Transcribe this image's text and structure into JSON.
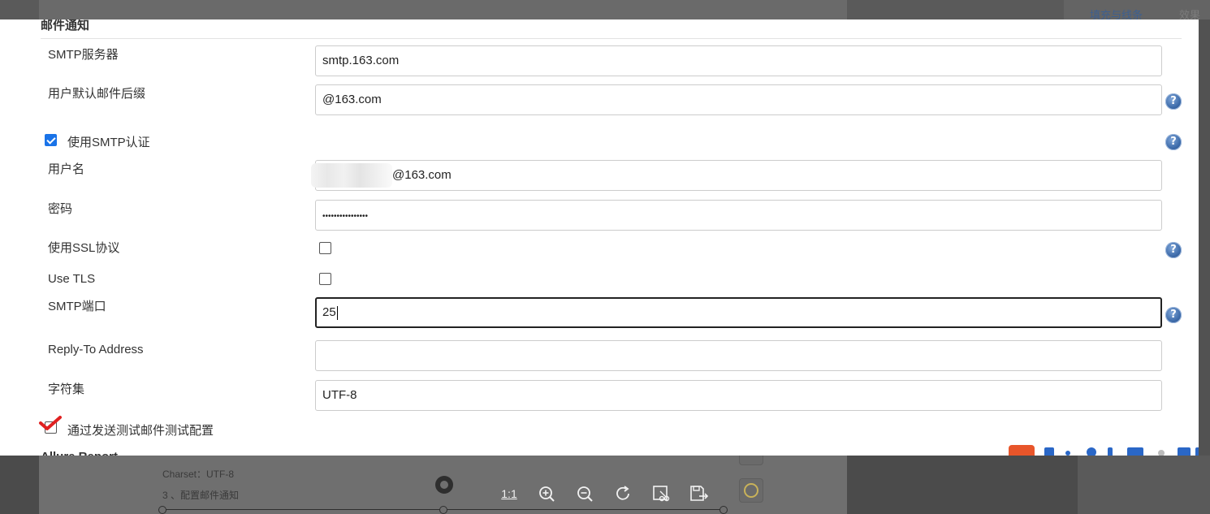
{
  "backdrop": {
    "top_link": "填充与线条",
    "top_link_2": "效果",
    "doc_charset_line": "Charset：UTF-8",
    "doc_step_line": "3 、配置邮件通知",
    "doc_cut_line": "邮件通知"
  },
  "section": {
    "title": "邮件通知",
    "next_title": "Allure Report"
  },
  "fields": {
    "smtp_server": {
      "label": "SMTP服务器",
      "value": "smtp.163.com"
    },
    "default_suffix": {
      "label": "用户默认邮件后缀",
      "value": "@163.com"
    },
    "use_smtp_auth": {
      "label": "使用SMTP认证",
      "checked": true
    },
    "username": {
      "label": "用户名",
      "value": "@163.com"
    },
    "password": {
      "label": "密码",
      "value": "••••••••••••••••"
    },
    "use_ssl": {
      "label": "使用SSL协议",
      "checked": false
    },
    "use_tls": {
      "label": "Use TLS",
      "checked": false
    },
    "smtp_port": {
      "label": "SMTP端口",
      "value": "25"
    },
    "reply_to": {
      "label": "Reply-To Address",
      "value": ""
    },
    "charset": {
      "label": "字符集",
      "value": "UTF-8"
    },
    "test_config": {
      "label": "通过发送测试邮件测试配置",
      "checked": true
    }
  },
  "help": {
    "glyph": "?"
  },
  "viewer_toolbar": {
    "actual_size_label": "1:1",
    "tools": [
      "zoom-in-icon",
      "zoom-out-icon",
      "rotate-icon",
      "crop-icon",
      "save-icon"
    ]
  },
  "colors": {
    "accent_blue": "#1a73e8",
    "help_blue": "#3c6aa9",
    "annotation_red": "#e02020",
    "overlay": "#525252"
  }
}
